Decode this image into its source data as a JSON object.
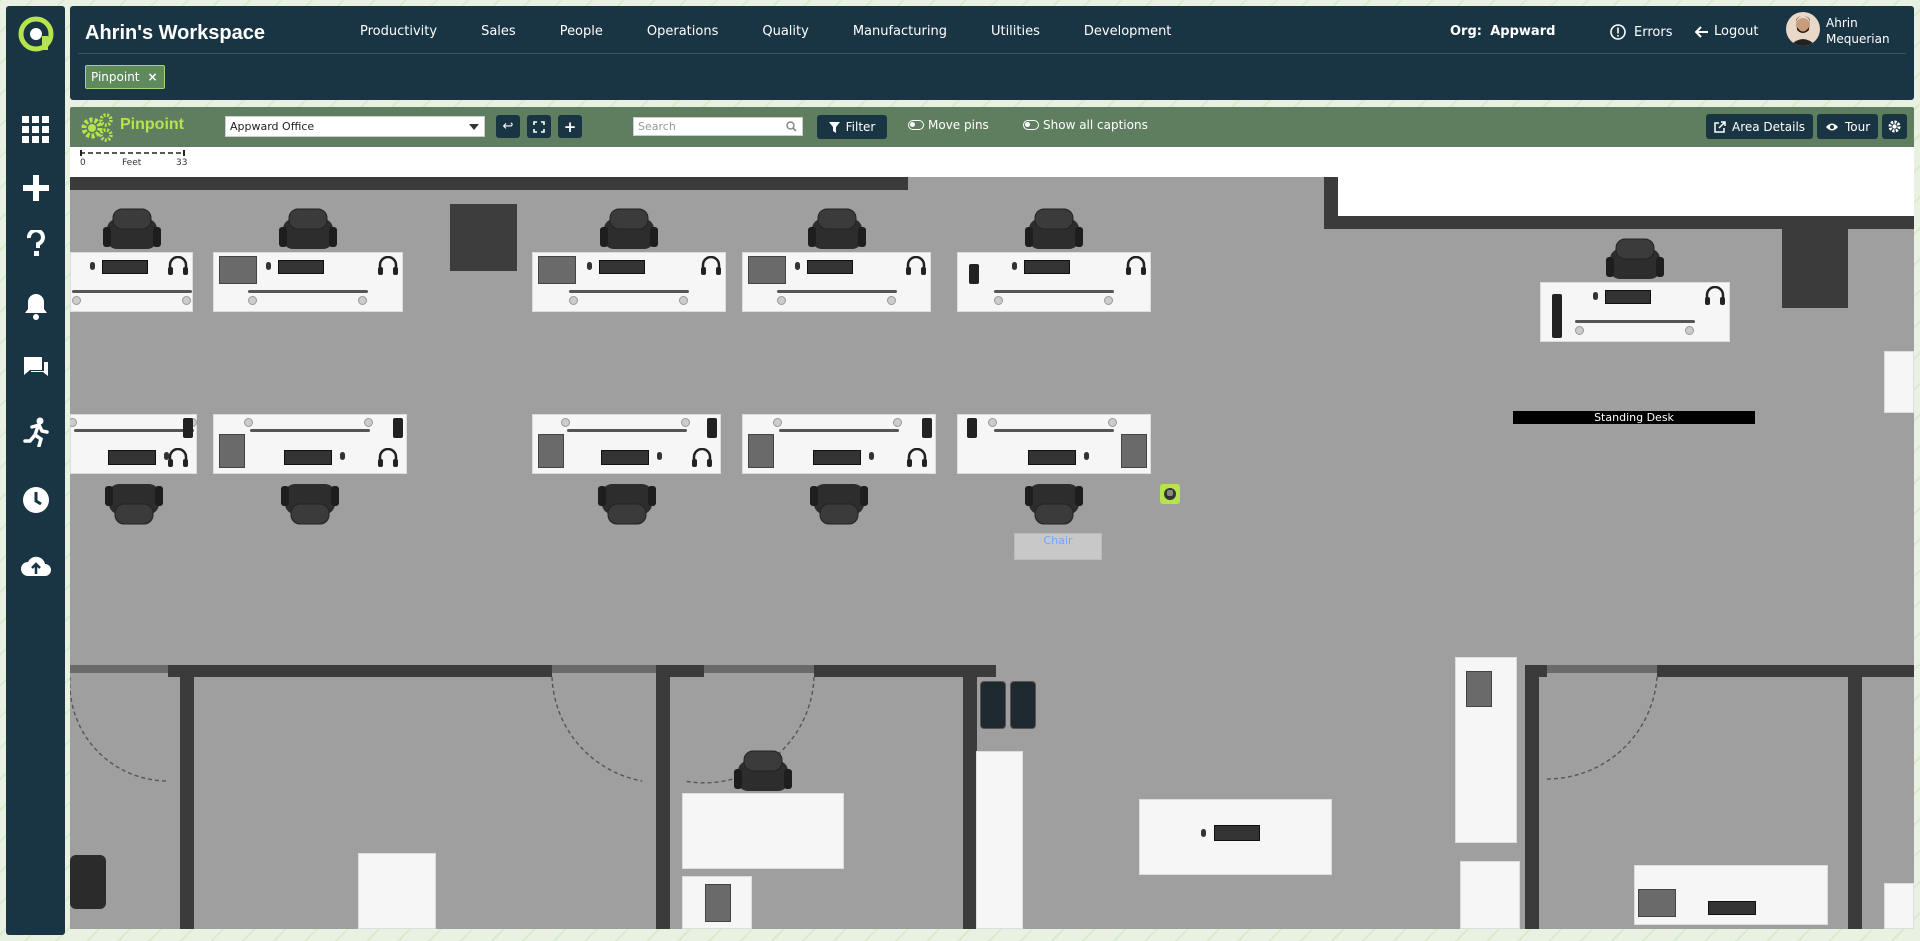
{
  "workspace": {
    "title": "Ahrin's Workspace"
  },
  "nav": [
    "Productivity",
    "Sales",
    "People",
    "Operations",
    "Quality",
    "Manufacturing",
    "Utilities",
    "Development"
  ],
  "header": {
    "org_label": "Org:",
    "org_value": "Appward",
    "errors": "Errors",
    "logout": "Logout",
    "user_first": "Ahrin",
    "user_last": "Mequerian"
  },
  "tabs": [
    {
      "label": "Pinpoint"
    }
  ],
  "toolbar": {
    "title": "Pinpoint",
    "office_select": "Appward Office",
    "search_placeholder": "Search",
    "filter": "Filter",
    "move_pins": "Move pins",
    "show_captions": "Show all captions",
    "area_details": "Area Details",
    "tour": "Tour"
  },
  "scale": {
    "start": "0",
    "unit": "Feet",
    "end": "33"
  },
  "map": {
    "standing_desk_label": "Standing Desk",
    "chair_caption": "Chair"
  },
  "colors": {
    "navy": "#193543",
    "accent": "#b7e34c",
    "toolbar": "#5e7e5f",
    "floor": "#9f9f9f"
  }
}
